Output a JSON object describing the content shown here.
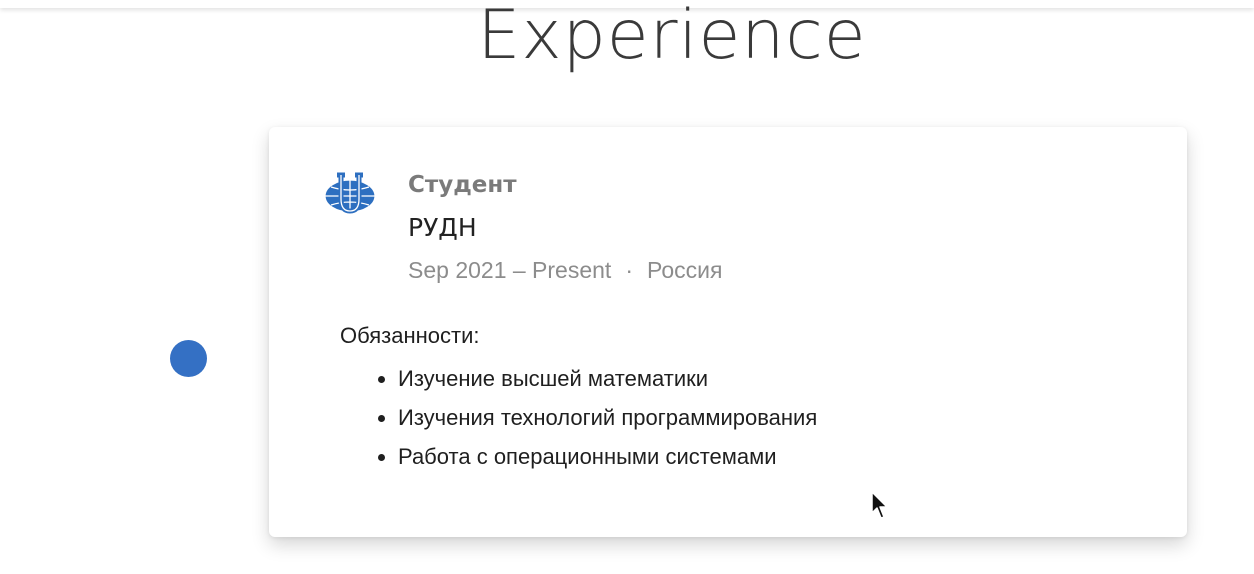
{
  "section": {
    "title": "Experience"
  },
  "colors": {
    "timeline_dot": "#3470c4",
    "logo_blue": "#2d6fc0"
  },
  "experience": {
    "logo_icon": "university-globe-logo",
    "role": "Студент",
    "organization": "РУДН",
    "period": "Sep 2021 – Present",
    "separator": "·",
    "location": "Россия",
    "duties_title": "Обязанности:",
    "duties": [
      "Изучение высшей математики",
      "Изучения технологий программирования",
      "Работа с операционными системами"
    ]
  },
  "cursor_icon": "mouse-pointer-icon"
}
